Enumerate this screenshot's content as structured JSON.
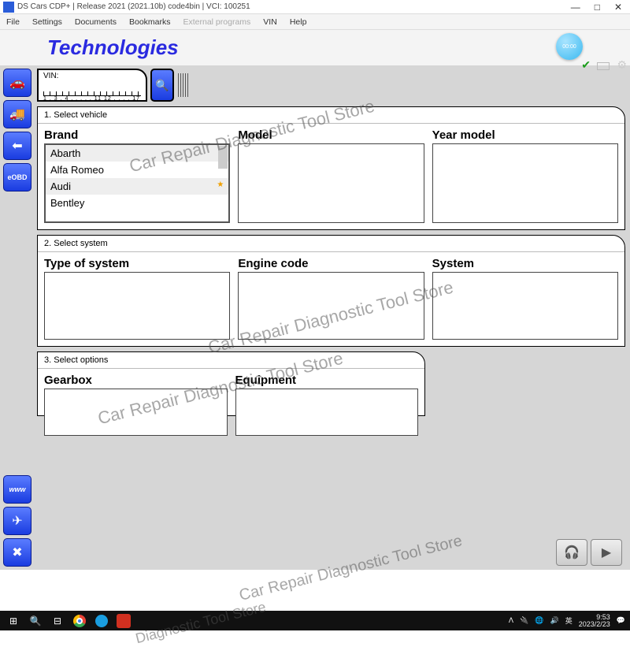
{
  "window": {
    "title": "DS Cars CDP+ | Release 2021 (2021.10b) code4bin | VCI: 100251",
    "min": "—",
    "max": "□",
    "close": "✕"
  },
  "menu": {
    "file": "File",
    "settings": "Settings",
    "documents": "Documents",
    "bookmarks": "Bookmarks",
    "external": "External programs",
    "vin": "VIN",
    "help": "Help"
  },
  "brand": {
    "name": "Technologies",
    "badge": "00:00"
  },
  "vin": {
    "label": "VIN:",
    "ruler": "1 . 3 . 4 . . . . . 11 12 . . . . 17"
  },
  "sections": {
    "s1": {
      "title": "1. Select vehicle",
      "brand_hdr": "Brand",
      "model_hdr": "Model",
      "year_hdr": "Year model",
      "brands": [
        {
          "name": "Abarth",
          "alt": true
        },
        {
          "name": "Alfa Romeo",
          "alt": false
        },
        {
          "name": "Audi",
          "alt": true,
          "star": true
        },
        {
          "name": "Bentley",
          "alt": false
        }
      ]
    },
    "s2": {
      "title": "2. Select system",
      "type_hdr": "Type of system",
      "engine_hdr": "Engine code",
      "system_hdr": "System"
    },
    "s3": {
      "title": "3. Select options",
      "gear_hdr": "Gearbox",
      "equip_hdr": "Equipment"
    }
  },
  "taskbar": {
    "lang": "英",
    "time": "9:53",
    "date": "2023/2/23"
  },
  "watermark": "Car Repair Diagnostic Tool Store"
}
